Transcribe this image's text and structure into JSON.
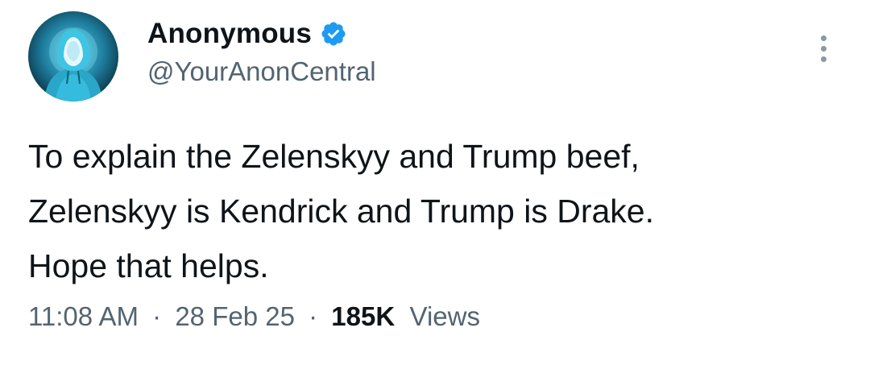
{
  "author": {
    "display_name": "Anonymous",
    "handle": "@YourAnonCentral",
    "verified": true,
    "avatar_icon": "hooded-figure-avatar",
    "verified_icon": "verified-badge-icon",
    "verified_color": "#1d9bf0"
  },
  "tweet": {
    "text_lines": [
      "To explain the Zelenskyy and Trump beef,",
      "Zelenskyy is Kendrick and Trump is Drake.",
      "Hope that helps."
    ]
  },
  "meta": {
    "time": "11:08 AM",
    "separator": "·",
    "date": "28 Feb 25",
    "views_count": "185K",
    "views_label": "Views"
  },
  "actions": {
    "more_icon": "more-vertical-icon"
  },
  "colors": {
    "text_primary": "#0f1419",
    "text_secondary": "#536471",
    "background": "#ffffff"
  }
}
